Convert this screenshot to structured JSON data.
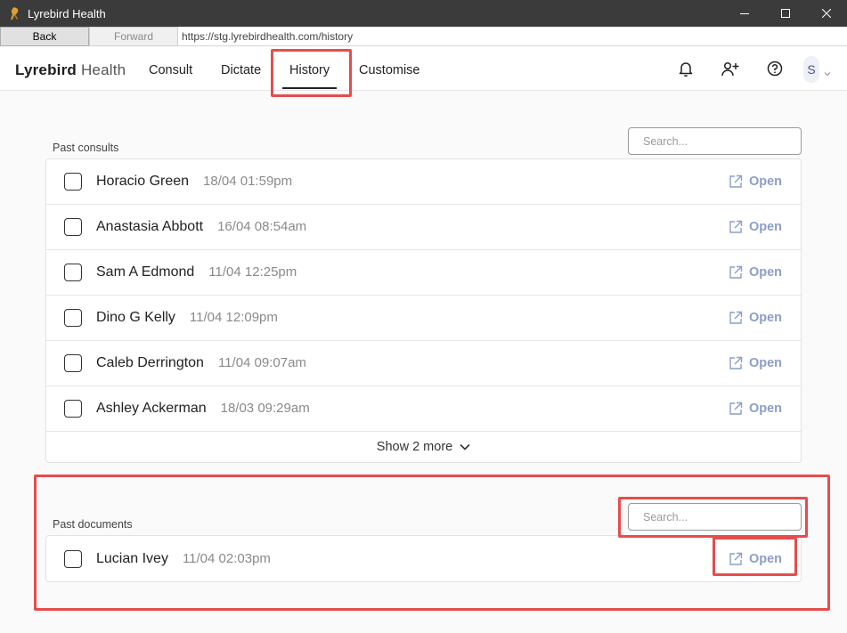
{
  "window": {
    "title": "Lyrebird Health",
    "app_icon": "lyrebird-icon",
    "controls": [
      "minimize-icon",
      "maximize-icon",
      "close-icon"
    ]
  },
  "navbar": {
    "back_label": "Back",
    "forward_label": "Forward",
    "url": "https://stg.lyrebirdhealth.com/history"
  },
  "header": {
    "logo_bold": "Lyrebird",
    "logo_light": "Health",
    "tabs": [
      {
        "label": "Consult"
      },
      {
        "label": "Dictate"
      },
      {
        "label": "History",
        "active": true
      },
      {
        "label": "Customise"
      }
    ],
    "icons": [
      "bell-icon",
      "add-user-icon",
      "help-icon"
    ],
    "avatar_initial": "S"
  },
  "past_consults": {
    "label": "Past consults",
    "search_placeholder": "Search...",
    "rows": [
      {
        "name": "Horacio Green",
        "time": "18/04 01:59pm",
        "open": "Open"
      },
      {
        "name": "Anastasia Abbott",
        "time": "16/04 08:54am",
        "open": "Open"
      },
      {
        "name": "Sam A Edmond",
        "time": "11/04 12:25pm",
        "open": "Open"
      },
      {
        "name": "Dino G Kelly",
        "time": "11/04 12:09pm",
        "open": "Open"
      },
      {
        "name": "Caleb Derrington",
        "time": "11/04 09:07am",
        "open": "Open"
      },
      {
        "name": "Ashley Ackerman",
        "time": "18/03 09:29am",
        "open": "Open"
      }
    ],
    "show_more": "Show 2 more"
  },
  "past_documents": {
    "label": "Past documents",
    "search_placeholder": "Search...",
    "rows": [
      {
        "name": "Lucian Ivey",
        "time": "11/04 02:03pm",
        "open": "Open"
      }
    ]
  },
  "colors": {
    "accent": "#8c9ec8",
    "highlight": "#e74c4c",
    "titlebar": "#3b3b3b"
  }
}
